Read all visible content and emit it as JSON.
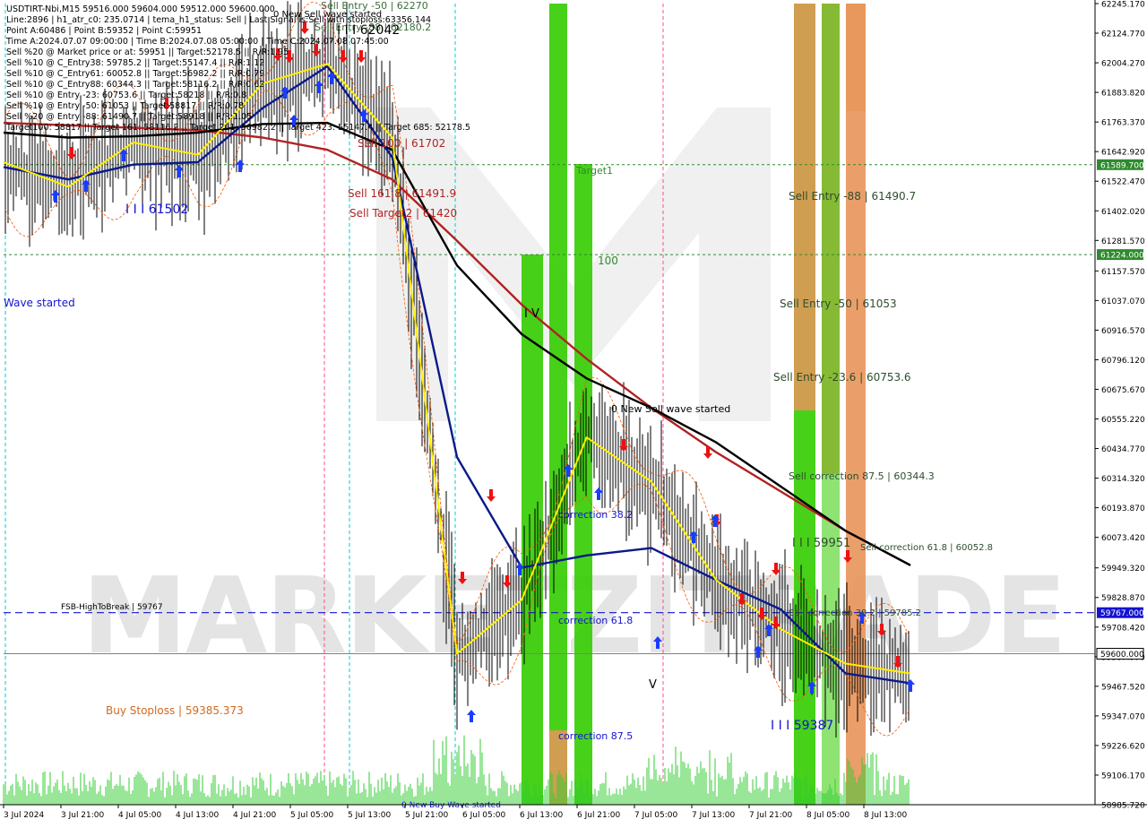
{
  "chart_data": {
    "type": "line",
    "symbol": "USDTIRT-Nbi,M15",
    "ohlc": {
      "open": 59516.0,
      "high": 59604.0,
      "low": 59512.0,
      "close": 59600.0
    },
    "info_lines": [
      "USDTIRT-Nbi,M15  59516.000 59604.000 59512.000 59600.000",
      "Line:2896 | h1_atr_c0: 235.0714 | tema_h1_status: Sell | Last Signal is:Sell with stoploss:63356.144",
      "Point A:60486 | Point B:59352 | Point C:59951",
      "Time A:2024.07.07 09:00:00 | Time B:2024.07.08 05:00:00 | Time C:2024.07.08 07:45:00",
      "Sell %20 @ Market price or at: 59951 || Target:52178.5 || R/R:1.95",
      "Sell %10 @ C_Entry38: 59785.2 || Target:55147.4 || R/R:1.12",
      "Sell %10 @ C_Entry61: 60052.8 || Target:56982.2 || R/R:0.79",
      "Sell %10 @ C_Entry88: 60344.3 || Target:58116.2 || R/R:0.62",
      "Sell %10 @ Entry -23: 60753.6 || Target:58218 || R/R:0.8",
      "Sell %10 @ Entry -50: 61053 || Target:58817 || R/R:0.78",
      "Sell %20 @ Entry -88: 61490.7 || Target:58918 || R/R:1.05",
      "Target100: 58817 || Target 161: 58116.2 || Target 261: 56982.2 || Target 423: 55147.4 || Target 685: 52178.5"
    ],
    "y_ticks": [
      "62245.170",
      "62124.770",
      "62004.270",
      "61883.820",
      "61763.370",
      "61642.920",
      "61522.470",
      "61402.020",
      "61281.570",
      "61157.570",
      "61037.070",
      "60916.570",
      "60796.120",
      "60675.670",
      "60555.220",
      "60434.770",
      "60314.320",
      "60193.870",
      "60073.420",
      "59949.320",
      "59828.870",
      "59708.420",
      "59587.970",
      "59467.520",
      "59347.070",
      "59226.620",
      "59106.170",
      "58985.720"
    ],
    "y_range": [
      58985.72,
      62245.17
    ],
    "x_ticks": [
      "3 Jul 2024",
      "3 Jul 21:00",
      "4 Jul 05:00",
      "4 Jul 13:00",
      "4 Jul 21:00",
      "5 Jul 05:00",
      "5 Jul 13:00",
      "5 Jul 21:00",
      "6 Jul 05:00",
      "6 Jul 13:00",
      "6 Jul 21:00",
      "7 Jul 05:00",
      "7 Jul 13:00",
      "7 Jul 21:00",
      "8 Jul 05:00",
      "8 Jul 13:00"
    ],
    "price_tags": [
      {
        "text": "61589.700",
        "value": 61589.7,
        "color": "#2e8b2e"
      },
      {
        "text": "61224.000",
        "value": 61224.0,
        "color": "#2e8b2e"
      },
      {
        "text": "59767.000",
        "value": 59767.0,
        "color": "#1414d0"
      },
      {
        "text": "59600.000",
        "value": 59600.0,
        "color": "#000000"
      }
    ],
    "annotations": [
      {
        "text": "0 New Sell wave started",
        "color": "#000000"
      },
      {
        "text": "Sell Entry -50 | 62270",
        "color": "#3a6e3a"
      },
      {
        "text": "Sell Entry -88 | 62180.2",
        "color": "#3a6e3a"
      },
      {
        "text": "I I I 62042",
        "color": "#000000"
      },
      {
        "text": "Sell 100 | 61702",
        "color": "#b22222"
      },
      {
        "text": "Sell 161.8 | 61491.9",
        "color": "#b22222"
      },
      {
        "text": "Sell Target2 | 61420",
        "color": "#b22222"
      },
      {
        "text": "I I I 61502",
        "color": "#1414d0"
      },
      {
        "text": "Wave started",
        "color": "#1414d0"
      },
      {
        "text": "Target1",
        "color": "#2e8b2e"
      },
      {
        "text": "100",
        "color": "#2e8b2e"
      },
      {
        "text": "Sell Entry -88 | 61490.7",
        "color": "#2e4d2e"
      },
      {
        "text": "Sell Entry -50 | 61053",
        "color": "#2e4d2e"
      },
      {
        "text": "Sell Entry -23.6 | 60753.6",
        "color": "#2e4d2e"
      },
      {
        "text": "0 New Sell wave started",
        "color": "#000000"
      },
      {
        "text": "Sell correction 87.5 | 60344.3",
        "color": "#2e4d2e"
      },
      {
        "text": "I I I 59951",
        "color": "#2e4d2e"
      },
      {
        "text": "Sell correction 61.8 | 60052.8",
        "color": "#2e4d2e"
      },
      {
        "text": "Sell correction 38.2 | 59785.2",
        "color": "#2e4d2e"
      },
      {
        "text": "I V",
        "color": "#000000"
      },
      {
        "text": "V",
        "color": "#000000"
      },
      {
        "text": "correction 38.2",
        "color": "#1414d0"
      },
      {
        "text": "correction 61.8",
        "color": "#1414d0"
      },
      {
        "text": "correction 87.5",
        "color": "#1414d0"
      },
      {
        "text": "I I I 59387",
        "color": "#1414d0"
      },
      {
        "text": "FSB-HighToBreak | 59767",
        "color": "#000000"
      },
      {
        "text": "Buy Stoploss | 59385.373",
        "color": "#d2691e"
      },
      {
        "text": "0 New Buy Wave started",
        "color": "#1414d0"
      }
    ],
    "hlines": [
      {
        "value": 61589.7,
        "style": "dashed",
        "color": "#2e8b2e"
      },
      {
        "value": 61224.0,
        "style": "dashed",
        "color": "#2e8b2e"
      },
      {
        "value": 59767.0,
        "style": "dashed",
        "color": "#1414d0"
      },
      {
        "value": 59600.0,
        "style": "solid",
        "color": "#808080"
      }
    ],
    "zones": [
      {
        "from_tick": "6 Jul 13:00",
        "color": "#33cc00"
      },
      {
        "from_tick": "6 Jul 13:00",
        "color": "#33cc00"
      },
      {
        "from_tick": "6 Jul 21:00",
        "color": "#33cc00"
      },
      {
        "from_tick": "8 Jul 05:00",
        "color": "#33cc00"
      },
      {
        "from_tick": "8 Jul 05:00",
        "color": "#e8955a"
      }
    ],
    "series": [
      {
        "color": "#b22222",
        "values": [
          61760,
          61750,
          61740,
          61730,
          61700,
          61650,
          61530,
          61280,
          61020,
          60800,
          60600,
          60420,
          60260,
          60100,
          59960
        ]
      },
      {
        "color": "#000000",
        "values": [
          61720,
          61700,
          61705,
          61720,
          61755,
          61760,
          61650,
          61180,
          60900,
          60720,
          60600,
          60460,
          60280,
          60100,
          59960
        ]
      },
      {
        "color": "#0a1a8a",
        "values": [
          61580,
          61530,
          61590,
          61600,
          61820,
          61990,
          61620,
          60400,
          59950,
          60000,
          60030,
          59900,
          59780,
          59520,
          59480
        ]
      },
      {
        "color": "#ffee00",
        "values": [
          61600,
          61500,
          61680,
          61630,
          61920,
          62000,
          61700,
          59600,
          59820,
          60480,
          60300,
          59900,
          59700,
          59560,
          59520
        ]
      }
    ],
    "watermark": "MARKETZITRADE",
    "grid": false
  }
}
